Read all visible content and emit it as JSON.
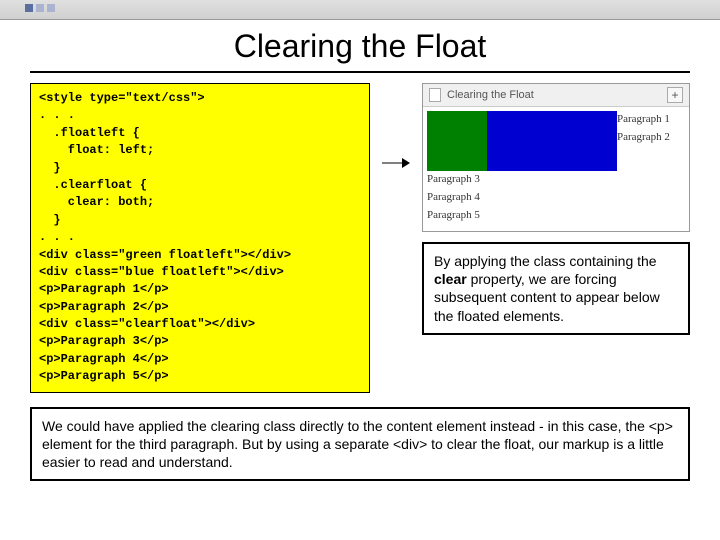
{
  "title": "Clearing the Float",
  "code": {
    "l1": "<style type=\"text/css\">",
    "l2": ". . .",
    "l3": "  .floatleft {",
    "l4": "    float: left;",
    "l5": "  }",
    "l6": "  .clearfloat {",
    "l7": "    clear: both;",
    "l8": "  }",
    "l9": ". . .",
    "l10": "<div class=\"green floatleft\"></div>",
    "l11": "<div class=\"blue floatleft\"></div>",
    "l12": "<p>Paragraph 1</p>",
    "l13": "<p>Paragraph 2</p>",
    "l14": "<div class=\"clearfloat\"></div>",
    "l15": "<p>Paragraph 3</p>",
    "l16": "<p>Paragraph 4</p>",
    "l17": "<p>Paragraph 5</p>"
  },
  "preview": {
    "tab_label": "Clearing the Float",
    "plus": "+",
    "p1": "Paragraph 1",
    "p2": "Paragraph 2",
    "p3": "Paragraph 3",
    "p4": "Paragraph 4",
    "p5": "Paragraph 5"
  },
  "explain": {
    "part1": "By applying the class containing the ",
    "bold": "clear",
    "part2": " property, we are forcing subsequent content to appear below the floated elements."
  },
  "bottom": "We could have applied the clearing class directly to the content element instead - in this case, the <p> element for the third paragraph.  But by using a separate <div> to clear the float, our markup is a little easier to read and understand."
}
